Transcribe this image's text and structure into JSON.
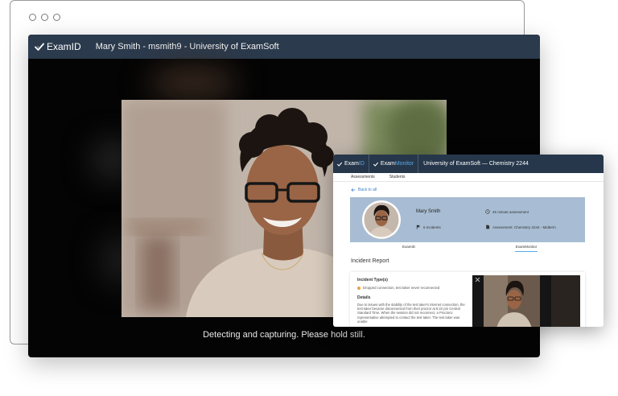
{
  "examid": {
    "brand": "ExamID",
    "user_line": "Mary Smith - msmith9 - University of ExamSoft",
    "status": "Detecting and capturing. Please hold still."
  },
  "monitor": {
    "brand_exam": "Exam",
    "brand_id": "ID",
    "brand_monitor_prefix": "Exam",
    "brand_monitor_suffix": "Monitor",
    "course": "University of ExamSoft  —  Chemistry 2244",
    "tabs": [
      "Assessments",
      "Students"
    ],
    "back_link": "Back to all",
    "profile": {
      "name": "Mary Smith",
      "incidents": "6 Incidents",
      "time": "45 minute assessment",
      "assessment": "Assessment: Chemistry 2244 - Midterm"
    },
    "sub_tabs": [
      "ExamID",
      "ExamMonitor"
    ],
    "report_title": "Incident Report",
    "incident_type_label": "Incident Type(s)",
    "incident_type": "Dropped connection, test taker never reconnected",
    "details_label": "Details",
    "details_text": "Due to issues with the stability of the test taker's internet connection, the test taker became disconnected from their proctor at 8:22 pm Central Standard Time.  When the session did not reconnect, a ProctorU representative attempted to contact the test taker. The test taker was unable"
  },
  "colors": {
    "header_dark": "#2b3a4c",
    "monitor_header": "#26374b",
    "accent_blue": "#5aa9e6",
    "profile_card": "#a8bdd3",
    "incident_dot": "#f0a03a"
  }
}
